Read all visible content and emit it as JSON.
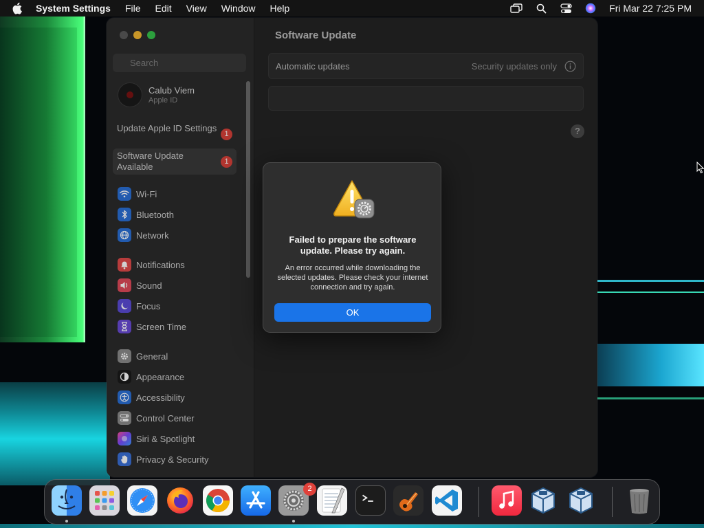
{
  "menubar": {
    "app_name": "System Settings",
    "menus": [
      "File",
      "Edit",
      "View",
      "Window",
      "Help"
    ],
    "clock": "Fri Mar 22  7:25 PM"
  },
  "sidebar": {
    "search_placeholder": "Search",
    "account": {
      "name": "Calub Viem",
      "subtitle": "Apple ID"
    },
    "alerts": [
      {
        "label": "Update Apple ID Settings",
        "badge": "1"
      },
      {
        "label": "Software Update Available",
        "badge": "1"
      }
    ],
    "groups": [
      [
        {
          "label": "Wi-Fi",
          "icon": "wifi-icon",
          "color": "#2a6fd6"
        },
        {
          "label": "Bluetooth",
          "icon": "bluetooth-icon",
          "color": "#2a6fd6"
        },
        {
          "label": "Network",
          "icon": "globe-icon",
          "color": "#2a6fd6"
        }
      ],
      [
        {
          "label": "Notifications",
          "icon": "bell-icon",
          "color": "#e04a4a"
        },
        {
          "label": "Sound",
          "icon": "speaker-icon",
          "color": "#e04a5a"
        },
        {
          "label": "Focus",
          "icon": "moon-icon",
          "color": "#5b4bd6"
        },
        {
          "label": "Screen Time",
          "icon": "hourglass-icon",
          "color": "#6a4bd6"
        }
      ],
      [
        {
          "label": "General",
          "icon": "gear-icon",
          "color": "#8a8a8a"
        },
        {
          "label": "Appearance",
          "icon": "appearance-icon",
          "color": "#1a1a1a"
        },
        {
          "label": "Accessibility",
          "icon": "accessibility-icon",
          "color": "#2a6fd6"
        },
        {
          "label": "Control Center",
          "icon": "control-center-icon",
          "color": "#8a8a8a"
        },
        {
          "label": "Siri & Spotlight",
          "icon": "siri-icon",
          "color": "#c04ad6"
        },
        {
          "label": "Privacy & Security",
          "icon": "hand-icon",
          "color": "#3a6fd6"
        }
      ]
    ]
  },
  "main": {
    "title": "Software Update",
    "automatic_updates_label": "Automatic updates",
    "automatic_updates_value": "Security updates only",
    "help_label": "?"
  },
  "dialog": {
    "title": "Failed to prepare the software update. Please try again.",
    "message": "An error occurred while downloading the selected updates. Please check your internet connection and try again.",
    "ok_label": "OK"
  },
  "dock": {
    "apps": [
      {
        "name": "Finder",
        "icon": "finder-icon",
        "running": true
      },
      {
        "name": "Launchpad",
        "icon": "launchpad-icon",
        "running": false
      },
      {
        "name": "Safari",
        "icon": "safari-icon",
        "running": false
      },
      {
        "name": "Firefox",
        "icon": "firefox-icon",
        "running": false
      },
      {
        "name": "Chrome",
        "icon": "chrome-icon",
        "running": false
      },
      {
        "name": "App Store",
        "icon": "app-store-icon",
        "running": false
      },
      {
        "name": "System Settings",
        "icon": "system-settings-icon",
        "running": true,
        "badge": "2"
      },
      {
        "name": "TextEdit",
        "icon": "textedit-icon",
        "running": false
      },
      {
        "name": "Terminal",
        "icon": "terminal-icon",
        "running": false
      },
      {
        "name": "GarageBand",
        "icon": "garageband-icon",
        "running": false
      },
      {
        "name": "Visual Studio Code",
        "icon": "vscode-icon",
        "running": false
      },
      {
        "name": "Music",
        "icon": "music-icon",
        "running": false
      },
      {
        "name": "VirtualBox",
        "icon": "virtualbox-icon",
        "running": false
      },
      {
        "name": "VirtualBox VM",
        "icon": "virtualbox-icon",
        "running": false
      },
      {
        "name": "Trash",
        "icon": "trash-icon",
        "running": false
      }
    ]
  }
}
